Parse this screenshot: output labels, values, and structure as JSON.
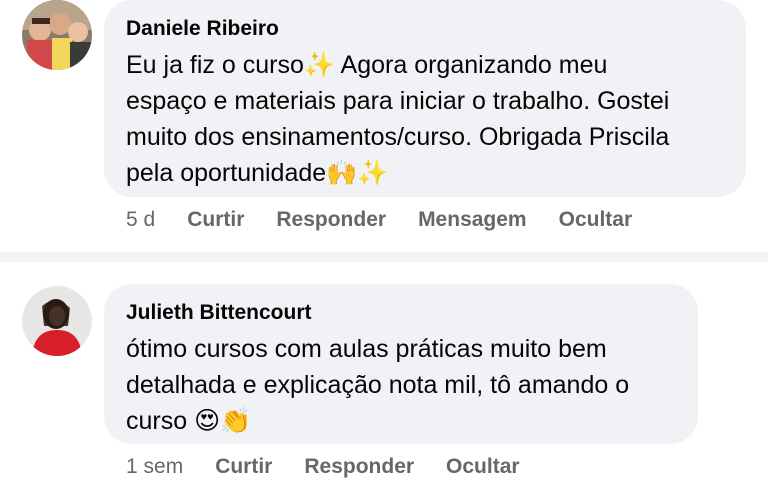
{
  "comments": [
    {
      "author": "Daniele Ribeiro",
      "text": "Eu ja fiz o curso✨ Agora organizando meu\nespaço e materiais para iniciar o trabalho. Gostei\nmuito dos ensinamentos/curso. Obrigada Priscila\npela oportunidade🙌✨",
      "time": "5 d",
      "actions": [
        "Curtir",
        "Responder",
        "Mensagem",
        "Ocultar"
      ]
    },
    {
      "author": "Julieth Bittencourt",
      "text": "ótimo cursos com aulas práticas muito bem\ndetalhada e explicação nota mil, tô amando o\ncurso 😍👏",
      "time": "1 sem",
      "actions": [
        "Curtir",
        "Responder",
        "Ocultar"
      ]
    }
  ],
  "colors": {
    "bubble": "#f0f2f5",
    "meta": "#65676b",
    "text": "#050505"
  }
}
